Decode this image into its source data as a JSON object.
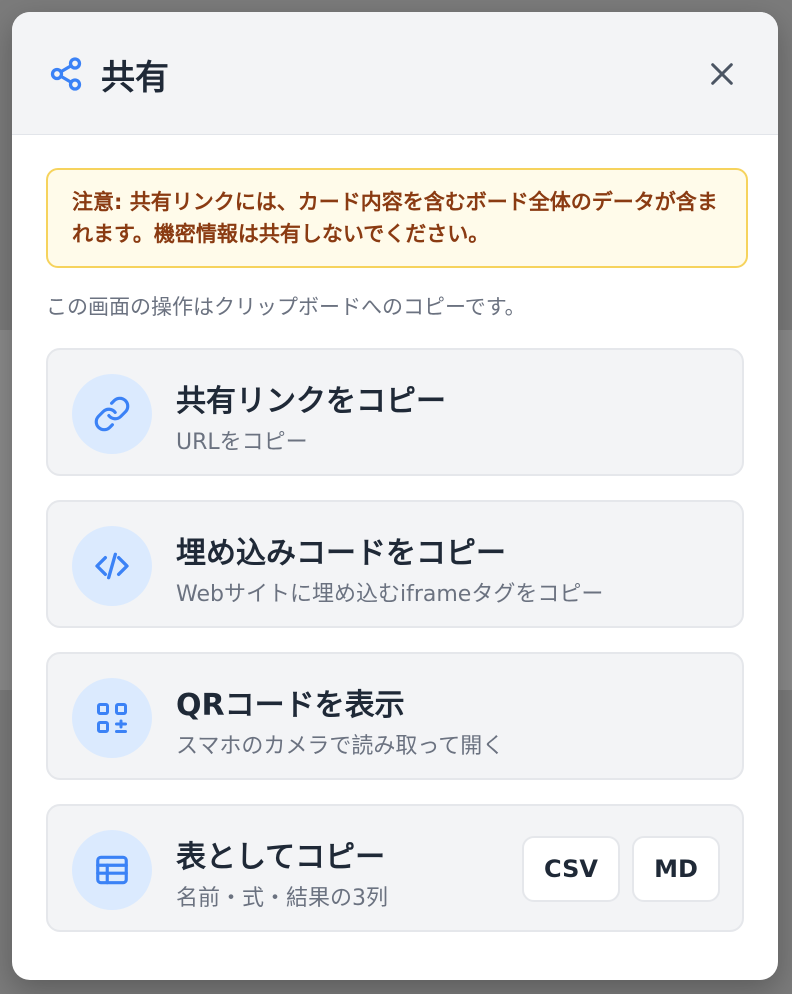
{
  "modal": {
    "title": "共有",
    "close_icon": "close-icon",
    "share_icon": "share-icon",
    "warning": "注意: 共有リンクには、カード内容を含むボード全体のデータが含まれます。機密情報は共有しないでください。",
    "note": "この画面の操作はクリップボードへのコピーです。",
    "actions": [
      {
        "icon": "link-icon",
        "title": "共有リンクをコピー",
        "subtitle": "URLをコピー"
      },
      {
        "icon": "code-icon",
        "title": "埋め込みコードをコピー",
        "subtitle": "Webサイトに埋め込むiframeタグをコピー"
      },
      {
        "icon": "qr-code-icon",
        "title": "QRコードを表示",
        "subtitle": "スマホのカメラで読み取って開く"
      },
      {
        "icon": "table-icon",
        "title": "表としてコピー",
        "subtitle": "名前・式・結果の3列",
        "buttons": [
          "CSV",
          "MD"
        ]
      }
    ]
  },
  "colors": {
    "accent": "#3b82f6",
    "warning_text": "#8a3b12",
    "warning_bg": "#fffbea",
    "warning_border": "#f6d35d"
  }
}
